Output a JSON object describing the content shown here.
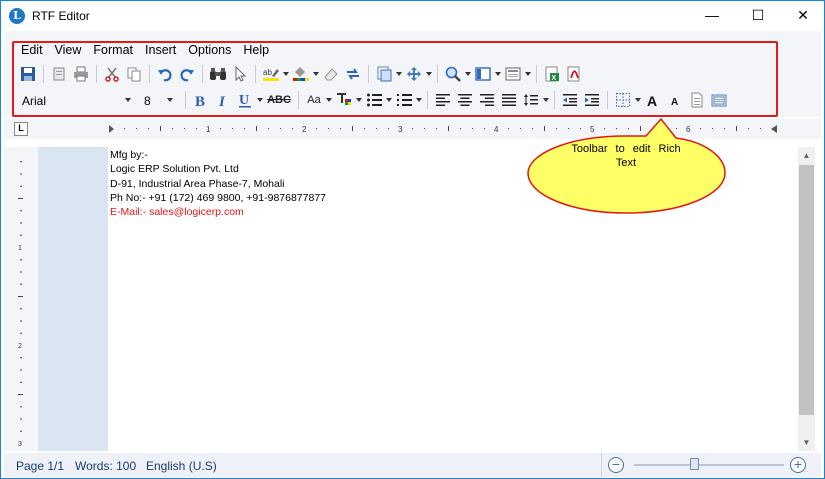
{
  "window": {
    "title": "RTF Editor",
    "minimize": "—",
    "maximize": "☐",
    "close": "✕"
  },
  "menu": [
    "Edit",
    "View",
    "Format",
    "Insert",
    "Options",
    "Help"
  ],
  "font": {
    "family": "Arial",
    "size": "8"
  },
  "toolbar2_labels": {
    "strike": "ABC",
    "case": "Aa"
  },
  "ruler": {
    "h_marks": [
      "1",
      "2",
      "3",
      "4",
      "5",
      "6"
    ],
    "v_marks": [
      "1",
      "2",
      "3"
    ]
  },
  "document": {
    "lines": [
      {
        "text": "Mfg by:-",
        "color": "#000000"
      },
      {
        "text": "Logic ERP Solution Pvt. Ltd",
        "color": "#000000"
      },
      {
        "text": "D-91, Industrial Area Phase-7, Mohali",
        "color": "#000000"
      },
      {
        "text": "Ph No:- +91 (172) 469 9800, +91-9876877877",
        "color": "#000000"
      },
      {
        "text": "E-Mail:- sales@logicerp.com",
        "color": "#e4141b"
      }
    ]
  },
  "callout": {
    "text": "Toolbar to edit Rich Text"
  },
  "status": {
    "page": "Page 1/1",
    "words": "Words: 100",
    "language": "English (U.S)"
  },
  "zoom": {
    "minus": "−",
    "plus": "+",
    "level": 0.4
  },
  "colors": {
    "accent": "#1883d7",
    "highlight_border": "#e11a1a",
    "callout_fill": "#ffff66"
  }
}
